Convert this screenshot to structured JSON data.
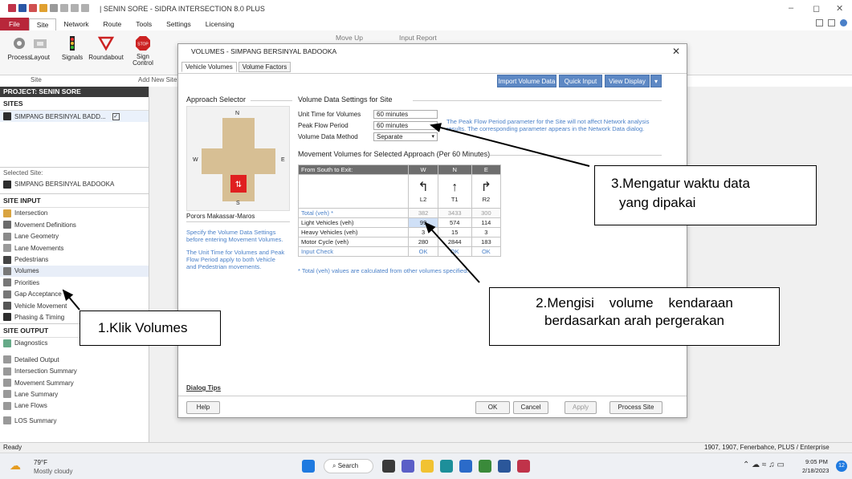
{
  "app": {
    "title": "| SENIN SORE - SIDRA INTERSECTION 8.0 PLUS"
  },
  "ribbon": {
    "tabs": [
      "File",
      "Site",
      "Network",
      "Route",
      "Tools",
      "Settings",
      "Licensing"
    ],
    "buttons": [
      {
        "label": "Process",
        "icon": "gear-icon"
      },
      {
        "label": "Layout",
        "icon": "layout-icon"
      },
      {
        "label": "Signals",
        "icon": "traffic-light-icon"
      },
      {
        "label": "Roundabout",
        "icon": "roundabout-icon"
      },
      {
        "label": "Sign\nControl",
        "icon": "stop-sign-icon"
      }
    ],
    "group_site": "Site",
    "group_add": "Add New Site",
    "grey_move": "Move Up",
    "grey_report": "Input Report"
  },
  "left": {
    "project": "PROJECT: SENIN SORE",
    "sites_header": "SITES",
    "site_name": "SIMPANG BERSINYAL BADD...",
    "selected_label": "Selected Site:",
    "selected_value": "SIMPANG BERSINYAL BADOOKA",
    "site_input_header": "SITE INPUT",
    "input_items": [
      "Intersection",
      "Movement Definitions",
      "Lane Geometry",
      "Lane Movements",
      "Pedestrians",
      "Volumes",
      "Priorities",
      "Gap Acceptance",
      "Vehicle Movement",
      "Phasing & Timing"
    ],
    "site_output_header": "SITE OUTPUT",
    "output_items": [
      "Diagnostics",
      "Detailed Output",
      "Intersection Summary",
      "Movement Summary",
      "Lane Summary",
      "Lane Flows",
      "LOS Summary"
    ]
  },
  "dialog": {
    "title": "VOLUMES - SIMPANG BERSINYAL BADOOKA",
    "tabs": [
      "Vehicle Volumes",
      "Volume Factors"
    ],
    "top_buttons": [
      "Import Volume Data",
      "Quick Input",
      "View Display"
    ],
    "approach_title": "Approach Selector",
    "compass": {
      "n": "N",
      "w": "W",
      "e": "E",
      "s": "S"
    },
    "road_name": "Porors Makassar-Maros",
    "note1": "Specify the Volume Data Settings before entering Movement Volumes.",
    "note2": "The Unit Time for Volumes and Peak Flow Period apply to both Vehicle and Pedestrian movements.",
    "settings_title": "Volume Data Settings for Site",
    "unit_time_label": "Unit Time for Volumes",
    "unit_time_value": "60 minutes",
    "peak_flow_label": "Peak Flow Period",
    "peak_flow_value": "60 minutes",
    "method_label": "Volume Data Method",
    "method_value": "Separate",
    "peak_note": "The Peak Flow Period parameter for the Site will not affect Network analysis results. The corresponding parameter appears in the Network Data dialog.",
    "movement_title": "Movement Volumes for Selected Approach (Per 60 Minutes)",
    "table": {
      "corner": "From South to Exit:",
      "cols": [
        "W",
        "N",
        "E"
      ],
      "codes": [
        "L2",
        "T1",
        "R2"
      ],
      "rows": [
        {
          "label": "Total (veh) *",
          "values": [
            "382",
            "3433",
            "300"
          ]
        },
        {
          "label": "Light Vehicles (veh)",
          "values": [
            "99",
            "574",
            "114"
          ]
        },
        {
          "label": "Heavy Vehicles (veh)",
          "values": [
            "3",
            "15",
            "3"
          ]
        },
        {
          "label": "Motor Cycle (veh)",
          "values": [
            "280",
            "2844",
            "183"
          ]
        },
        {
          "label": "Input Check",
          "values": [
            "OK",
            "OK",
            "OK"
          ]
        }
      ]
    },
    "footnote": "* Total (veh) values are calculated from other volumes specified.",
    "dialog_tips": "Dialog Tips",
    "buttons": {
      "help": "Help",
      "ok": "OK",
      "cancel": "Cancel",
      "apply": "Apply",
      "process": "Process Site"
    }
  },
  "annotations": {
    "a1": "1.Klik Volumes",
    "a2_l1": "2.Mengisi    volume    kendaraan",
    "a2_l2": "berdasarkan arah pergerakan",
    "a3_l1": "3.Mengatur waktu data",
    "a3_l2": "yang dipakai"
  },
  "status": {
    "left": "Ready",
    "right": "1907, 1907, Fenerbahce, PLUS / Enterprise"
  },
  "taskbar": {
    "weather_temp": "79°F",
    "weather_desc": "Mostly cloudy",
    "search": "Search",
    "time": "9:05 PM",
    "date": "2/18/2023",
    "badge": "12"
  }
}
